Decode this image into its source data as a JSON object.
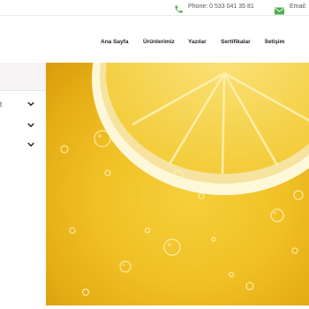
{
  "topbar": {
    "phone_label": "Phone: 0 533 041 35 81",
    "email_label": "Email:",
    "accent": "#4caf50"
  },
  "nav": {
    "items": [
      "Ana Sayfa",
      "Ürünlerimiz",
      "Yazılar",
      "Sertifikalar",
      "İletişim"
    ]
  },
  "sidebar": {
    "rows": [
      {
        "stub": "t",
        "icon": "chevron-down-icon"
      },
      {
        "icon": "chevron-down-icon"
      },
      {
        "icon": "chevron-down-icon"
      }
    ]
  },
  "hero": {
    "image": "lemon-slice-in-yellow-liquid-with-bubbles",
    "colors": {
      "base": "#f0c126",
      "rind": "#fff6c8",
      "pulp": "#f7d64c"
    }
  }
}
